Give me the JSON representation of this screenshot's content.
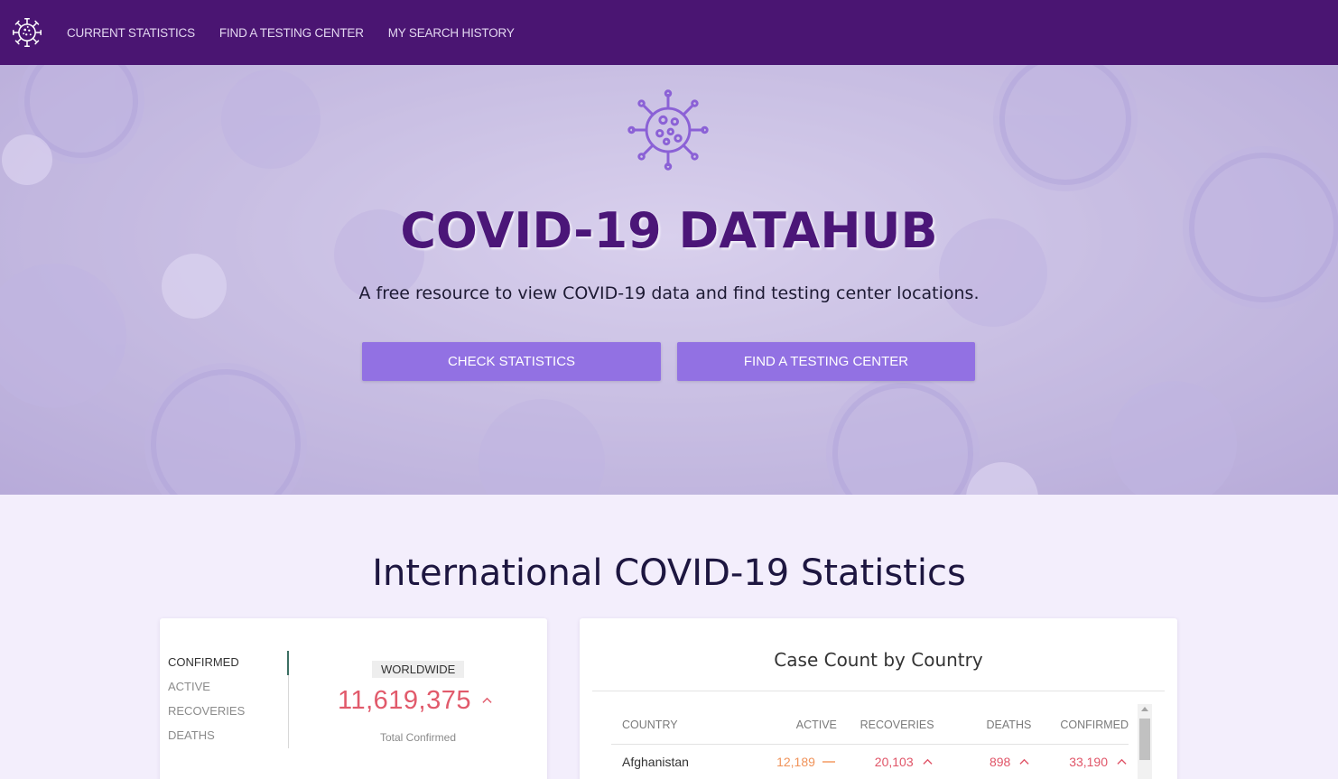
{
  "colors": {
    "nav_bg": "#4a1572",
    "hero_title": "#4b1678",
    "button_bg": "#9271e3",
    "confirmed_red": "#e15a6b",
    "active_orange": "#f0935a",
    "section_bg": "#f3eefc"
  },
  "nav": {
    "logo_icon": "virus-icon",
    "links": [
      "CURRENT STATISTICS",
      "FIND A TESTING CENTER",
      "MY SEARCH HISTORY"
    ]
  },
  "hero": {
    "icon": "virus-icon",
    "title": "COVID-19 DATAHUB",
    "subtitle": "A free resource to view COVID-19 data and find testing center locations.",
    "buttons": [
      "CHECK STATISTICS",
      "FIND A TESTING CENTER"
    ]
  },
  "stats": {
    "title": "International COVID-19 Statistics",
    "menu": [
      "CONFIRMED",
      "ACTIVE",
      "RECOVERIES",
      "DEATHS"
    ],
    "selected": "CONFIRMED",
    "worldwide_badge": "WORLDWIDE",
    "worldwide_value": "11,619,375",
    "worldwide_label": "Total Confirmed",
    "trend_icon": "chevron-up-icon"
  },
  "country_table": {
    "title": "Case Count by Country",
    "headers": [
      "COUNTRY",
      "ACTIVE",
      "RECOVERIES",
      "DEATHS",
      "CONFIRMED"
    ],
    "rows": [
      {
        "country": "Afghanistan",
        "active": "12,189",
        "active_trend": "flat",
        "recoveries": "20,103",
        "recoveries_trend": "up",
        "deaths": "898",
        "deaths_trend": "up",
        "confirmed": "33,190",
        "confirmed_trend": "up"
      }
    ]
  }
}
